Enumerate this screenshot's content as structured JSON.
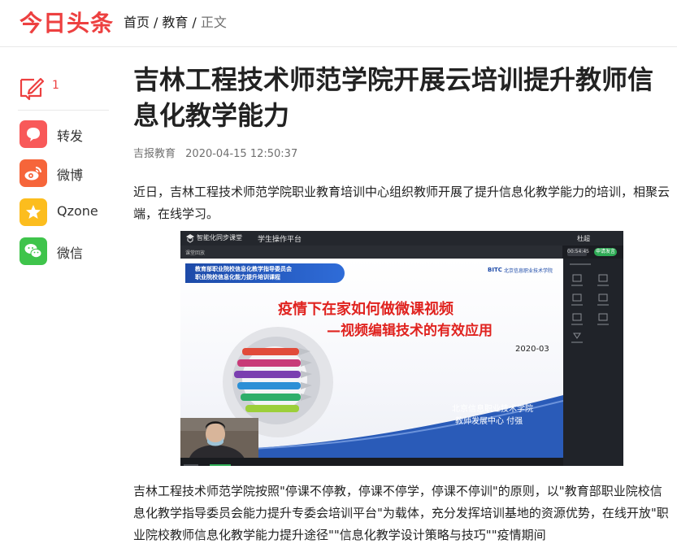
{
  "header": {
    "logo": "今日头条",
    "breadcrumb": [
      {
        "label": "首页"
      },
      {
        "label": "教育"
      },
      {
        "label": "正文"
      }
    ],
    "separator": "/"
  },
  "share_rail": {
    "comment_count": "1",
    "items": [
      {
        "label": "转发",
        "icon": "repost-icon",
        "color": "#f85959"
      },
      {
        "label": "微博",
        "icon": "weibo-icon",
        "color": "#f6653a"
      },
      {
        "label": "Qzone",
        "icon": "qzone-icon",
        "color": "#fcbd1e"
      },
      {
        "label": "微信",
        "icon": "wechat-icon",
        "color": "#3fc44b"
      }
    ]
  },
  "article": {
    "title": "吉林工程技术师范学院开展云培训提升教师信息化教学能力",
    "source": "吉报教育",
    "time": "2020-04-15 12:50:37",
    "paragraph1": "近日，吉林工程技术师范学院职业教育培训中心组织教师开展了提升信息化教学能力的培训，相聚云端，在线学习。",
    "paragraph2": "吉林工程技术师范学院按照\"停课不停教，停课不停学，停课不停训\"的原则，以\"教育部职业院校信息化教学指导委员会能力提升专委会培训平台\"为载体，充分发挥培训基地的资源优势，在线开放\"职业院校教师信息化教学能力提升途径\"\"信息化教学设计策略与技巧\"\"疫情期间"
  },
  "figure": {
    "app_name": "智能化同步课堂",
    "platform": "学生操作平台",
    "user_name": "杜超",
    "sub_left": "课堂回放",
    "time_badge": "00:54:45",
    "green_button": "申请发言",
    "ribbon_line1": "教育部职业院校信息化教学指导委员会",
    "ribbon_line2": "职业院校信息化能力提升培训课程",
    "bito": "BITC",
    "bito_school": "北京信息职业技术学院",
    "slide_title1": "疫情下在家如何做微课视频",
    "slide_title2": "—视频编辑技术的有效应用",
    "slide_date": "2020-03",
    "slide_footer1": "北京信息职业技术学院",
    "slide_footer2": "教师发展中心   付强"
  },
  "colors": {
    "brand_red": "#ed4040",
    "text": "#222222",
    "muted": "#707070"
  }
}
